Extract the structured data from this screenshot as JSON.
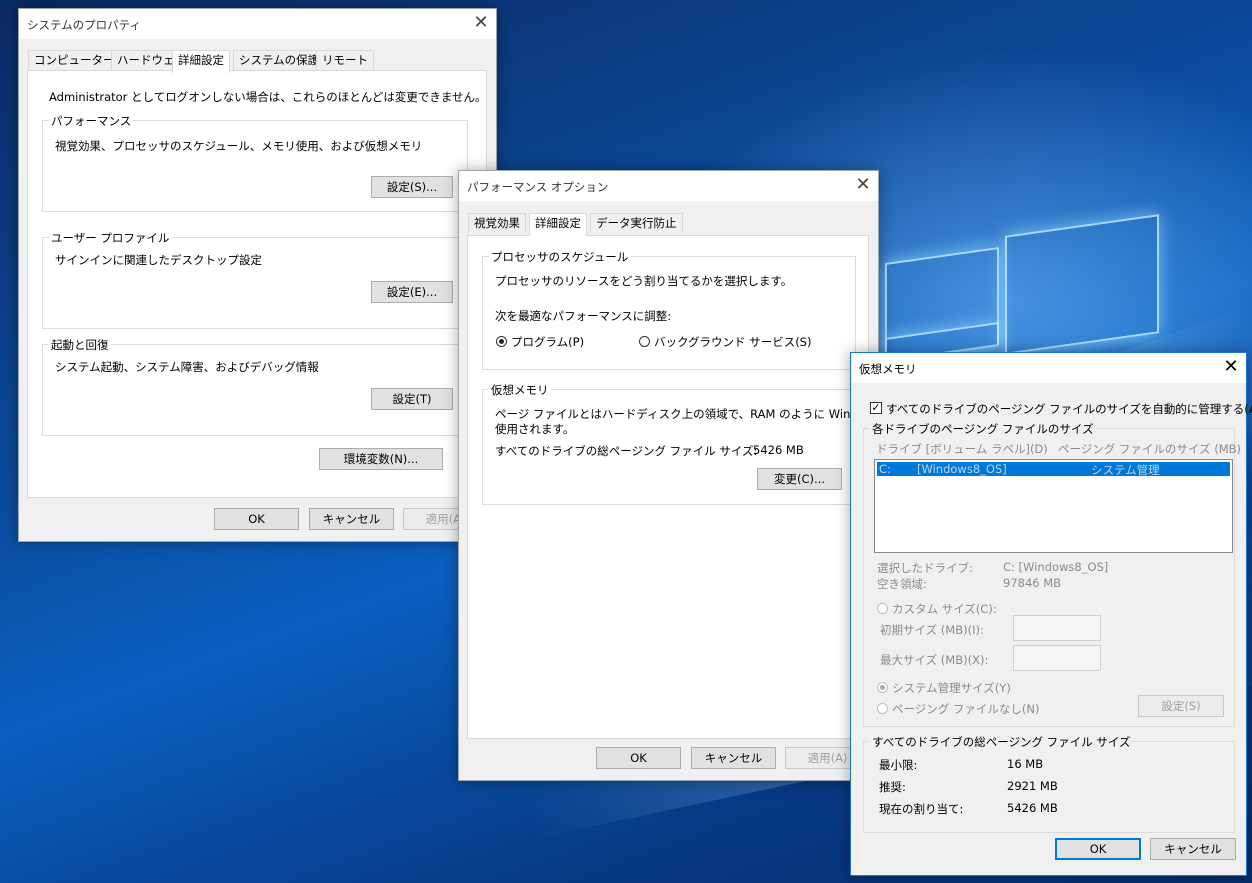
{
  "sysprop": {
    "title": "システムのプロパティ",
    "tabs": [
      "コンピューター名",
      "ハードウェア",
      "詳細設定",
      "システムの保護",
      "リモート"
    ],
    "admin_note": "Administrator としてログオンしない場合は、これらのほとんどは変更できません。",
    "performance": {
      "label": "パフォーマンス",
      "desc": "視覚効果、プロセッサのスケジュール、メモリ使用、および仮想メモリ",
      "button": "設定(S)..."
    },
    "user_profile": {
      "label": "ユーザー プロファイル",
      "desc": "サインインに関連したデスクトップ設定",
      "button": "設定(E)..."
    },
    "startup": {
      "label": "起動と回復",
      "desc": "システム起動、システム障害、およびデバッグ情報",
      "button": "設定(T)"
    },
    "env_button": "環境変数(N)...",
    "ok": "OK",
    "cancel": "キャンセル",
    "apply": "適用(A)"
  },
  "perf": {
    "title": "パフォーマンス オプション",
    "tabs": [
      "視覚効果",
      "詳細設定",
      "データ実行防止"
    ],
    "sched": {
      "label": "プロセッサのスケジュール",
      "desc": "プロセッサのリソースをどう割り当てるかを選択します。",
      "adjust": "次を最適なパフォーマンスに調整:",
      "program": "プログラム(P)",
      "background": "バックグラウンド サービス(S)"
    },
    "vm": {
      "label": "仮想メモリ",
      "desc1": "ページ ファイルとはハードディスク上の領域で、RAM のように Windows で",
      "desc2": "使用されます。",
      "total_label": "すべてのドライブの総ページング ファイル サイズ:",
      "total_value": "5426 MB",
      "change_button": "変更(C)..."
    },
    "ok": "OK",
    "cancel": "キャンセル",
    "apply": "適用(A)"
  },
  "vmem": {
    "title": "仮想メモリ",
    "auto_manage": "すべてのドライブのページング ファイルのサイズを自動的に管理する(A)",
    "per_drive_label": "各ドライブのページング ファイルのサイズ",
    "col_drive": "ドライブ [ボリューム ラベル](D)",
    "col_size": "ページング ファイルのサイズ (MB)",
    "row_drive": "C:",
    "row_volume": "[Windows8_OS]",
    "row_size": "システム管理",
    "selected_drive_label": "選択したドライブ:",
    "selected_drive_value": "C: [Windows8_OS]",
    "free_label": "空き領域:",
    "free_value": "97846 MB",
    "custom": "カスタム サイズ(C):",
    "initial": "初期サイズ (MB)(I):",
    "maximum": "最大サイズ (MB)(X):",
    "system_managed": "システム管理サイズ(Y)",
    "no_paging": "ページング ファイルなし(N)",
    "set_button": "設定(S)",
    "total_group": "すべてのドライブの総ページング ファイル サイズ",
    "min_label": "最小限:",
    "min_value": "16 MB",
    "rec_label": "推奨:",
    "rec_value": "2921 MB",
    "cur_label": "現在の割り当て:",
    "cur_value": "5426 MB",
    "ok": "OK",
    "cancel": "キャンセル"
  }
}
